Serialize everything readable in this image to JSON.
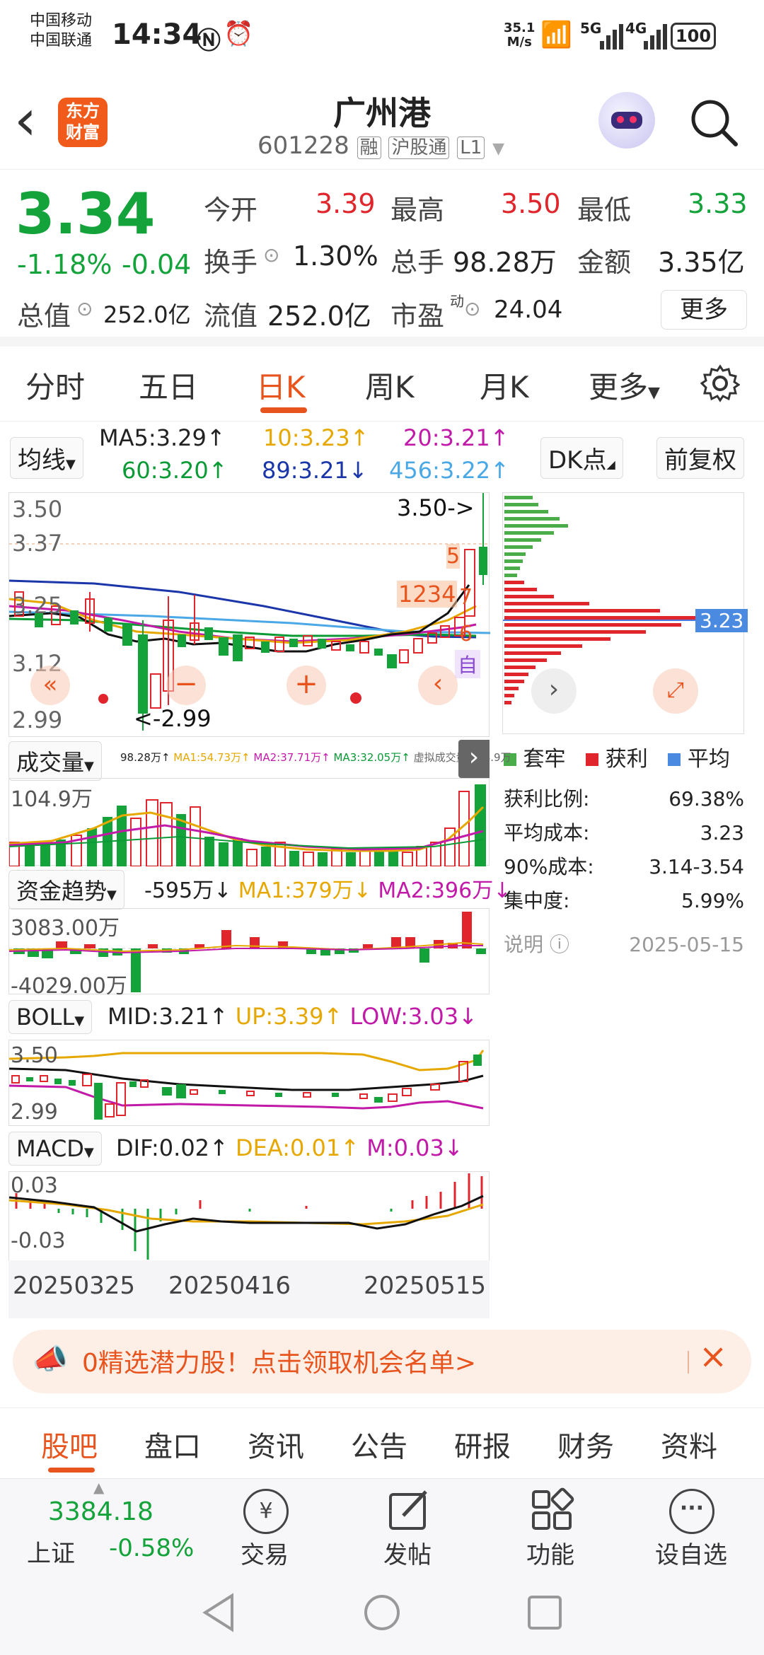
{
  "status": {
    "carrier1": "中国移动",
    "carrier2": "中国联通",
    "time": "14:34",
    "net_speed": "35.1",
    "net_unit": "M/s",
    "sig1": "5G",
    "sig2": "4G",
    "battery": "100"
  },
  "header": {
    "back": "‹",
    "logo_line1": "东方",
    "logo_line2": "财富",
    "title": "广州港",
    "code": "601228",
    "tag1": "融",
    "tag2": "沪股通",
    "tag3": "L1"
  },
  "quote": {
    "price": "3.34",
    "change_pct": "-1.18%",
    "change": "-0.04",
    "open_label": "今开",
    "open": "3.39",
    "high_label": "最高",
    "high": "3.50",
    "low_label": "最低",
    "low": "3.33",
    "turnover_label": "换手",
    "turnover": "1.30%",
    "volume_label": "总手",
    "volume": "98.28万",
    "amount_label": "金额",
    "amount": "3.35亿",
    "mcap_label": "总值",
    "mcap": "252.0亿",
    "float_label": "流值",
    "float": "252.0亿",
    "pe_label": "市盈",
    "pe_sup": "动",
    "pe": "24.04",
    "more": "更多"
  },
  "tabs": [
    "分时",
    "五日",
    "日K",
    "周K",
    "月K",
    "更多"
  ],
  "ma": {
    "btn": "均线",
    "ma5": "MA5:3.29↑",
    "ma10": "10:3.23↑",
    "ma20": "20:3.21↑",
    "ma60": "60:3.20↑",
    "ma89": "89:3.21↓",
    "ma456": "456:3.22↑",
    "dk": "DK点",
    "fq": "前复权"
  },
  "kline": {
    "y1": "3.50",
    "y2": "3.37",
    "y3": "3.25",
    "y4": "3.12",
    "y5": "2.99",
    "high_mark": "3.50->",
    "low_mark": "<-2.99",
    "sig_nums": [
      "1",
      "2",
      "3",
      "4",
      "5",
      "6",
      "7"
    ],
    "sig_zi": "自"
  },
  "chip": {
    "avg": "3.23",
    "leg1": "套牢",
    "leg2": "获利",
    "leg3": "平均",
    "rows": [
      {
        "k": "获利比例:",
        "v": "69.38%"
      },
      {
        "k": "平均成本:",
        "v": "3.23"
      },
      {
        "k": "90%成本:",
        "v": "3.14-3.54"
      },
      {
        "k": "集中度:",
        "v": "5.99%"
      }
    ],
    "note": "说明",
    "date": "2025-05-15"
  },
  "vol": {
    "btn": "成交量",
    "info": "98.28万↑",
    "ma1": "MA1:54.73万↑",
    "ma2": "MA2:37.71万↑",
    "ma3": "MA3:32.05万↑",
    "virt": "虚拟成交量:104.9万",
    "ymax": "104.9万"
  },
  "fund": {
    "btn": "资金趋势",
    "val": "-595万↓",
    "ma1": "MA1:379万↓",
    "ma2": "MA2:396万↓",
    "ytop": "3083.00万",
    "ybot": "-4029.00万"
  },
  "boll": {
    "btn": "BOLL",
    "mid": "MID:3.21↑",
    "up": "UP:3.39↑",
    "low": "LOW:3.03↓",
    "ytop": "3.50",
    "ybot": "2.99"
  },
  "macd": {
    "btn": "MACD",
    "dif": "DIF:0.02↑",
    "dea": "DEA:0.01↑",
    "m": "M:0.03↓",
    "ytop": "0.03",
    "ybot": "-0.03"
  },
  "dates": [
    "20250325",
    "20250416",
    "20250515"
  ],
  "ad": {
    "text": "0精选潜力股！点击领取机会名单>"
  },
  "bottom_tabs": [
    "股吧",
    "盘口",
    "资讯",
    "公告",
    "研报",
    "财务",
    "资料"
  ],
  "footer": {
    "index_val": "3384.18",
    "index_name": "上证",
    "index_chg": "-0.58%",
    "f1": "交易",
    "f2": "发帖",
    "f3": "功能",
    "f4": "设自选"
  },
  "colors": {
    "up": "#e0262c",
    "down": "#14a33a",
    "accent": "#e8541e"
  }
}
